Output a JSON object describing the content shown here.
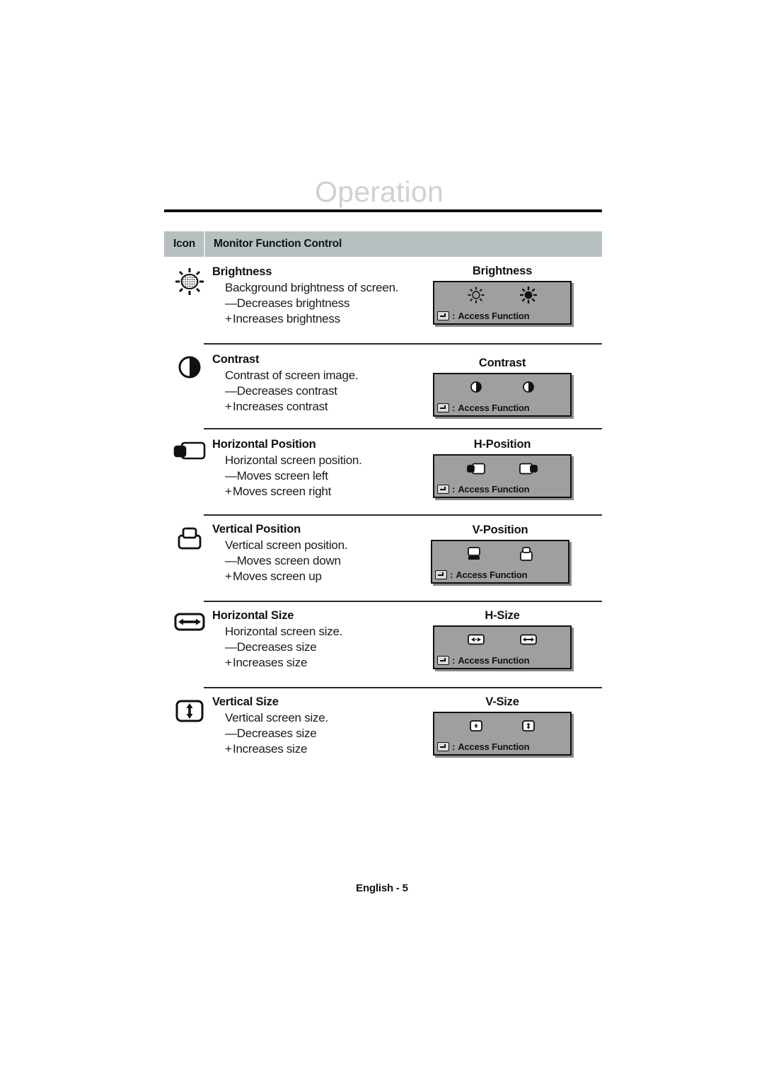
{
  "page": {
    "chapter_title": "Operation",
    "footer": "English - 5"
  },
  "table": {
    "header": {
      "icon_col": "Icon",
      "function_col": "Monitor Function Control"
    },
    "rows": [
      {
        "icon": "brightness-icon",
        "title": "Brightness",
        "description": "Background brightness of screen.",
        "minus_sign": "—",
        "minus_text": "Decreases brightness",
        "plus_sign": "+",
        "plus_text": "Increases brightness",
        "osd": {
          "label": "Brightness",
          "left_icon": "brightness-low-icon",
          "right_icon": "brightness-high-icon",
          "key_icon": "enter-key-icon",
          "colon": ":",
          "access_text": "Access Function"
        }
      },
      {
        "icon": "contrast-icon",
        "title": "Contrast",
        "description": "Contrast of screen image.",
        "minus_sign": "—",
        "minus_text": "Decreases contrast",
        "plus_sign": "+",
        "plus_text": "Increases contrast",
        "osd": {
          "label": "Contrast",
          "left_icon": "contrast-low-icon",
          "right_icon": "contrast-high-icon",
          "key_icon": "enter-key-icon",
          "colon": ":",
          "access_text": "Access Function"
        }
      },
      {
        "icon": "h-position-icon",
        "title": "Horizontal Position",
        "description": "Horizontal screen position.",
        "minus_sign": "—",
        "minus_text": "Moves screen left",
        "plus_sign": "+",
        "plus_text": "Moves screen right",
        "osd": {
          "label": "H-Position",
          "left_icon": "h-position-left-icon",
          "right_icon": "h-position-right-icon",
          "key_icon": "enter-key-icon",
          "colon": ":",
          "access_text": "Access Function"
        }
      },
      {
        "icon": "v-position-icon",
        "title": "Vertical Position",
        "description": "Vertical screen position.",
        "minus_sign": "—",
        "minus_text": "Moves screen down",
        "plus_sign": "+",
        "plus_text": "Moves screen up",
        "osd": {
          "label": "V-Position",
          "left_icon": "v-position-down-icon",
          "right_icon": "v-position-up-icon",
          "key_icon": "enter-key-icon",
          "colon": ":",
          "access_text": "Access Function"
        }
      },
      {
        "icon": "h-size-icon",
        "title": "Horizontal Size",
        "description": "Horizontal screen size.",
        "minus_sign": "—",
        "minus_text": "Decreases size",
        "plus_sign": "+",
        "plus_text": "Increases size",
        "osd": {
          "label": "H-Size",
          "left_icon": "h-size-decrease-icon",
          "right_icon": "h-size-increase-icon",
          "key_icon": "enter-key-icon",
          "colon": ":",
          "access_text": "Access Function"
        }
      },
      {
        "icon": "v-size-icon",
        "title": "Vertical Size",
        "description": "Vertical screen size.",
        "minus_sign": "—",
        "minus_text": "Decreases size",
        "plus_sign": "+",
        "plus_text": "Increases size",
        "osd": {
          "label": "V-Size",
          "left_icon": "v-size-decrease-icon",
          "right_icon": "v-size-increase-icon",
          "key_icon": "enter-key-icon",
          "colon": ":",
          "access_text": "Access Function"
        }
      }
    ]
  },
  "colors": {
    "header_bar": "#b6c0c0",
    "title_text": "#cdd2d2",
    "osd_background": "#9f9f9f",
    "rule": "#111111"
  }
}
